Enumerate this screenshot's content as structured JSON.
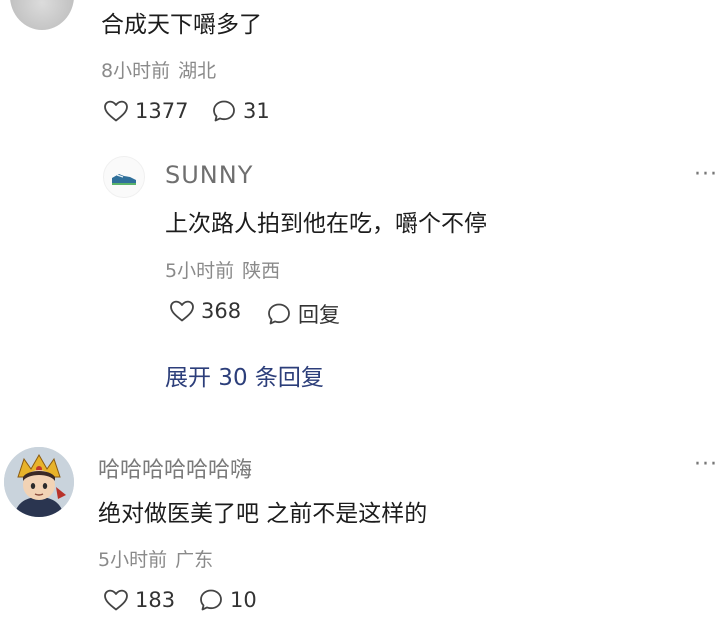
{
  "comment1": {
    "text": "合成天下嚼多了",
    "time": "8小时前",
    "location": "湖北",
    "likes": "1377",
    "replies": "31"
  },
  "reply": {
    "username": "SUNNY",
    "text": "上次路人拍到他在吃，嚼个不停",
    "time": "5小时前",
    "location": "陕西",
    "likes": "368",
    "reply_label": "回复",
    "more_label": "···"
  },
  "expand": {
    "label": "展开 30 条回复"
  },
  "comment2": {
    "username": "哈哈哈哈哈哈嗨",
    "text": "绝对做医美了吧 之前不是这样的",
    "time": "5小时前",
    "location": "广东",
    "likes": "183",
    "replies": "10",
    "more_label": "···"
  },
  "icons": {
    "like": "heart-outline-icon",
    "comment": "speech-bubble-icon",
    "more": "more-dots-icon"
  }
}
